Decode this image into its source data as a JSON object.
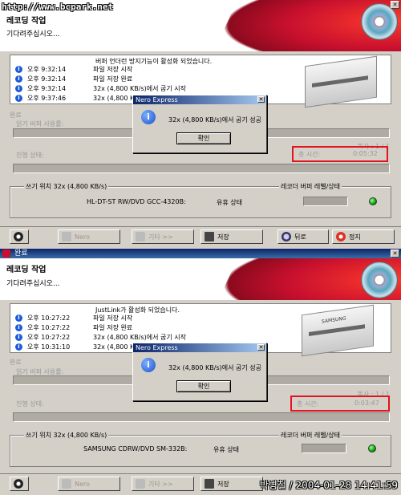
{
  "watermark": "http://www.bcpark.net",
  "stamp": "박병철 / 2004-01-28 14:41:59",
  "colors": {
    "accent_red": "#c8102e",
    "highlight": "#e0141e",
    "titlebar": "#0a246a"
  },
  "panel1": {
    "window_title": "",
    "header_title": "레코딩 작업",
    "header_subtitle": "기다려주십시오...",
    "log": [
      {
        "time": "",
        "msg": "버퍼 언더런 방지기능이 활성화 되었습니다."
      },
      {
        "time": "오후 9:32:14",
        "msg": "파일 저장 시작"
      },
      {
        "time": "오후 9:32:14",
        "msg": "파일 저장 완료"
      },
      {
        "time": "오후 9:32:14",
        "msg": "32x (4,800 KB/s)에서 굽기 시작"
      },
      {
        "time": "오후 9:37:46",
        "msg": "32x (4,800 KB/s)에서 굽기 성공"
      }
    ],
    "section_label": "완료",
    "buffer_label": "읽기 버퍼 사용률:",
    "copies": "복사 : 1 / 1",
    "elapsed_label": "총 시간:",
    "elapsed_value": "0:05:32",
    "progress_label": "진행 상태:",
    "write_speed": "쓰기 위치 32x (4,800 KB/s)",
    "recorder_label": "레코더 버퍼 레벨/상태",
    "drive": "HL-DT-ST RW/DVD GCC-4320B:",
    "drive_state": "유휴 상태",
    "dialog": {
      "title": "Nero Express",
      "message": "32x (4,800 KB/s)에서 굽기 성공",
      "ok": "확인"
    },
    "buttons": {
      "nero": "Nero",
      "more": "기타 >>",
      "save": "저장",
      "back": "뒤로",
      "stop": "정지"
    }
  },
  "panel2": {
    "window_title": "완료",
    "header_title": "레코딩 작업",
    "header_subtitle": "기다려주십시오...",
    "log": [
      {
        "time": "",
        "msg": "JustLink가 활성화 되었습니다."
      },
      {
        "time": "오후 10:27:22",
        "msg": "파일 저장 시작"
      },
      {
        "time": "오후 10:27:22",
        "msg": "파일 저장 완료"
      },
      {
        "time": "오후 10:27:22",
        "msg": "32x (4,800 KB/s)에서 굽기 시작"
      },
      {
        "time": "오후 10:31:10",
        "msg": "32x (4,800 KB/s)에서 굽기 성공"
      }
    ],
    "section_label": "완료",
    "buffer_label": "읽기 버퍼 사용률:",
    "copies": "복사 : 1 / 1",
    "elapsed_label": "총 시간:",
    "elapsed_value": "0:03:47",
    "progress_label": "진행 상태:",
    "write_speed": "쓰기 위치 32x (4,800 KB/s)",
    "recorder_label": "레코더 버퍼 레벨/상태",
    "drive": "SAMSUNG CDRW/DVD SM-332B:",
    "drive_state": "유휴 상태",
    "drive_brand": "SAMSUNG",
    "dialog": {
      "title": "Nero Express",
      "message": "32x (4,800 KB/s)에서 굽기 성공",
      "ok": "확인"
    },
    "buttons": {
      "nero": "Nero",
      "more": "기타 >>",
      "save": "저장"
    }
  }
}
